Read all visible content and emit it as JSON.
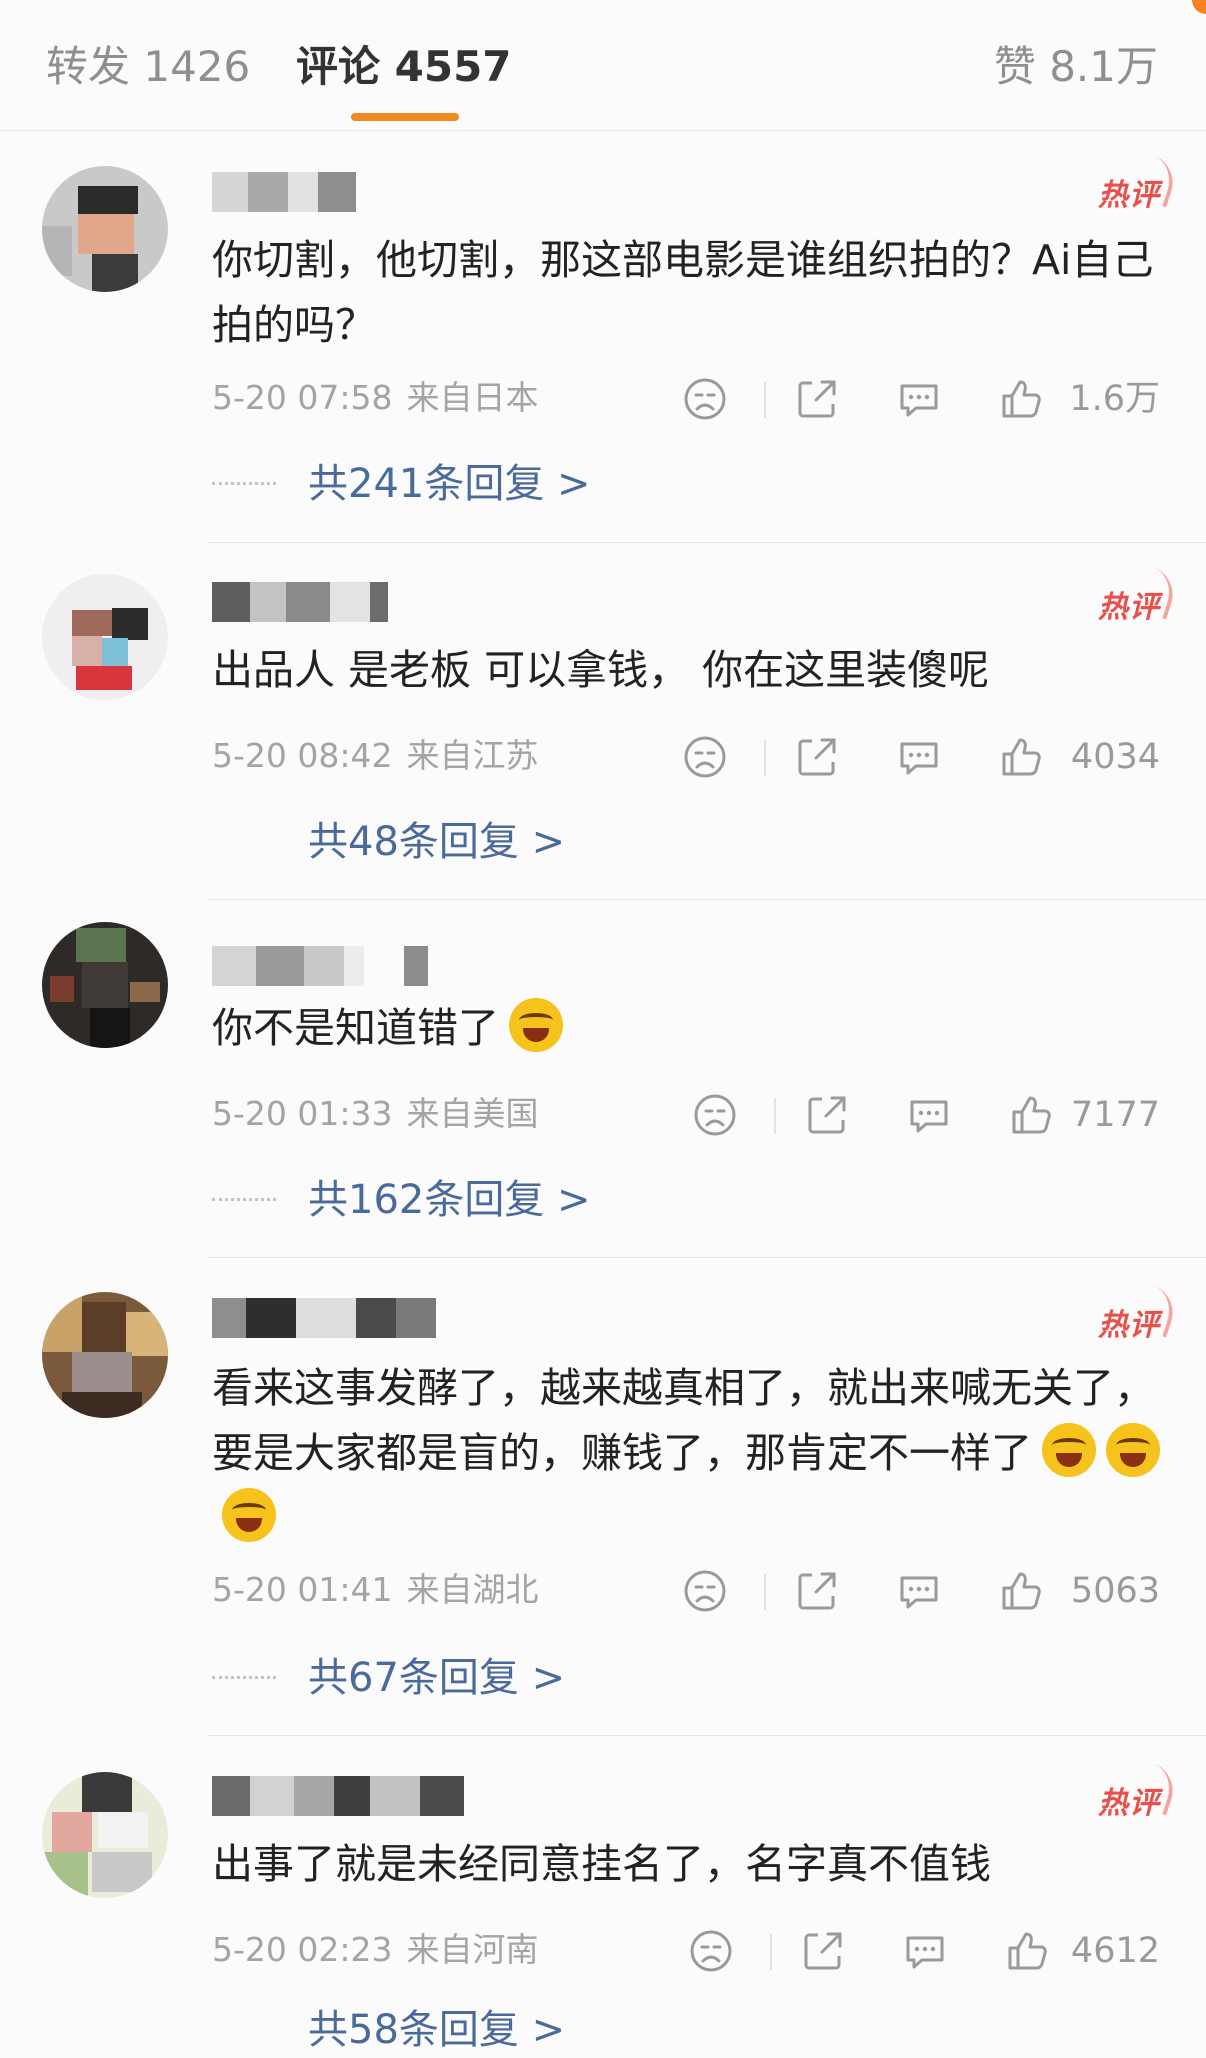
{
  "tabs": {
    "repost": "转发 1426",
    "comments": "评论 4557",
    "likes": "赞 8.1万"
  },
  "colors": {
    "accent": "#f08a1e",
    "hot_badge": "#e8514b",
    "reply_link": "#4a6a9b",
    "meta": "#a4a4a4"
  },
  "hot_label": "热评",
  "comments": [
    {
      "text": "你切割，他切割，那这部电影是谁组织拍的？Ai自己拍的吗？",
      "date": "5-20 07:58",
      "location": "来自日本",
      "likes": "1.6万",
      "replies": "共241条回复 >",
      "hot": true,
      "emoji_count": 0
    },
    {
      "text": "出品人 是老板 可以拿钱， 你在这里装傻呢",
      "date": "5-20 08:42",
      "location": "来自江苏",
      "likes": "4034",
      "replies": "共48条回复 >",
      "hot": true,
      "emoji_count": 0
    },
    {
      "text": "你不是知道错了",
      "date": "5-20 01:33",
      "location": "来自美国",
      "likes": "7177",
      "replies": "共162条回复 >",
      "hot": false,
      "emoji_count": 1
    },
    {
      "text": "看来这事发酵了，越来越真相了，就出来喊无关了，要是大家都是盲的，赚钱了，那肯定不一样了",
      "date": "5-20 01:41",
      "location": "来自湖北",
      "likes": "5063",
      "replies": "共67条回复 >",
      "hot": true,
      "emoji_count": 3
    },
    {
      "text": "出事了就是未经同意挂名了，名字真不值钱",
      "date": "5-20 02:23",
      "location": "来自河南",
      "likes": "4612",
      "replies": "共58条回复 >",
      "hot": true,
      "emoji_count": 0
    }
  ]
}
